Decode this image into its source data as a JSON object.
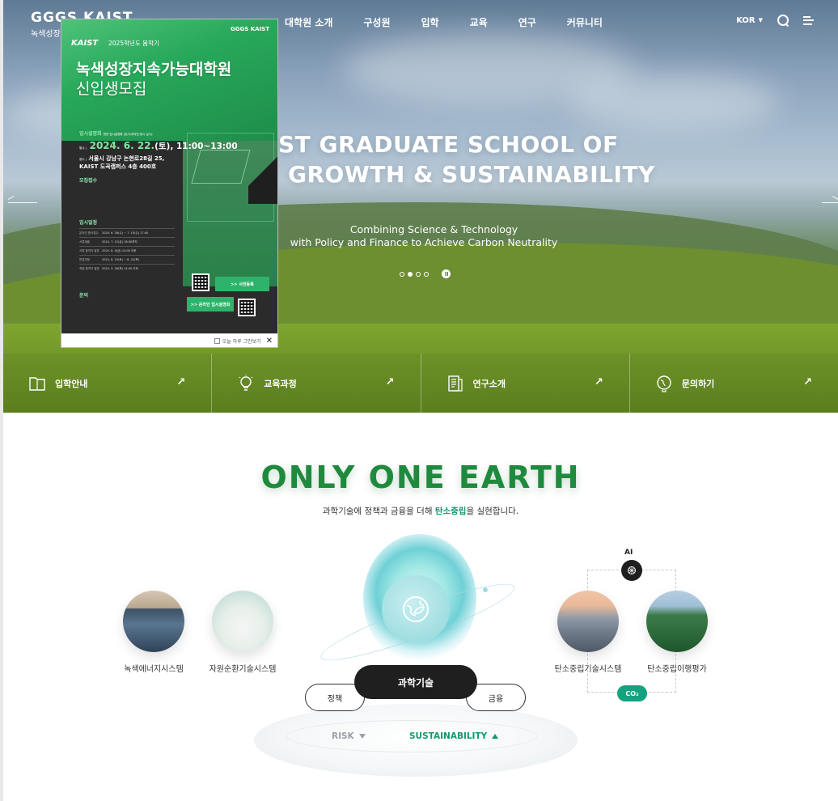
{
  "header": {
    "logo_mark": "GGGS KAIST",
    "logo_sub": "녹색성장지",
    "nav": [
      "대학원 소개",
      "구성원",
      "입학",
      "교육",
      "연구",
      "커뮤니티"
    ],
    "lang": "KOR",
    "icons": [
      "search-icon",
      "menu-icon",
      "chevron-down-icon"
    ]
  },
  "hero": {
    "title_line1": "ST GRADUATE SCHOOL OF",
    "title_line2": "GROWTH & SUSTAINABILITY",
    "subtitle_line1": "Combining Science & Technology",
    "subtitle_line2": "with Policy and Finance to Achieve Carbon Neutrality",
    "slides_count": 4,
    "active_slide": 2
  },
  "quick_links": [
    {
      "label": "입학안내",
      "icon": "book-icon"
    },
    {
      "label": "교육과정",
      "icon": "lightbulb-icon"
    },
    {
      "label": "연구소개",
      "icon": "document-icon"
    },
    {
      "label": "문의하기",
      "icon": "globe-icon"
    }
  ],
  "popup": {
    "kaist": "KAIST",
    "badge": "2025학년도 봄학기",
    "logo": "GGGS KAIST",
    "title_line1": "녹색성장지속가능대학원",
    "title_line2": "신입생모집",
    "session_label": "입시설명회",
    "session_note": "현장 입시설명회 (온/오프라인 동시 실시)",
    "date_prefix": "일시 |",
    "date": "2024. 6. 22.",
    "date_suffix": "(토), 11:00~13:00",
    "place_prefix": "장소 |",
    "place_line1": "서울시 강남구 논현로28길 25,",
    "place_line2": "KAIST 도곡캠퍼스 4층 400호",
    "recruit_label": "모집접수",
    "schedule_label": "입시일정",
    "contact_label": "문의",
    "schedule_rows": [
      {
        "k": "온라인 원서접수",
        "v": "2024. 6. 26(수) ~ 7. 10(수) 17:00"
      },
      {
        "k": "서류제출",
        "v": "2024. 7. 12(금) 18:00까지"
      },
      {
        "k": "서류 합격자 발표",
        "v": "2024. 8. 9(금) 14:00 이후"
      },
      {
        "k": "면접전형",
        "v": "2024. 8. 10(토) ~ 8. 22(목)"
      },
      {
        "k": "최종 합격자 발표",
        "v": "2024. 9. 26(목) 14:00 이후"
      }
    ],
    "btn1": ">> 사전등록",
    "btn2": ">> 온라인 입시설명회",
    "footer_text": "오늘 하루 그만보기",
    "close": "✕"
  },
  "section2": {
    "title": "ONLY ONE EARTH",
    "subtitle_pre": "과학기술에 정책과 금융을 더해 ",
    "subtitle_hl": "탄소중립",
    "subtitle_post": "을 실현합니다.",
    "items_left": [
      "녹색에너지시스템",
      "자원순환기술시스템"
    ],
    "items_right": [
      "탄소중립기술시스템",
      "탄소중립이행평가"
    ],
    "ai_label": "AI",
    "co2_label": "CO₂",
    "pill_main": "과학기술",
    "pill_left": "정책",
    "pill_right": "금융",
    "risk": "RISK",
    "sustainability": "SUSTAINABILITY"
  },
  "colors": {
    "accent_green": "#109a6b",
    "co2_teal": "#14a37f",
    "title_green": "#1f8a3e",
    "dark": "#1f1f1f"
  }
}
